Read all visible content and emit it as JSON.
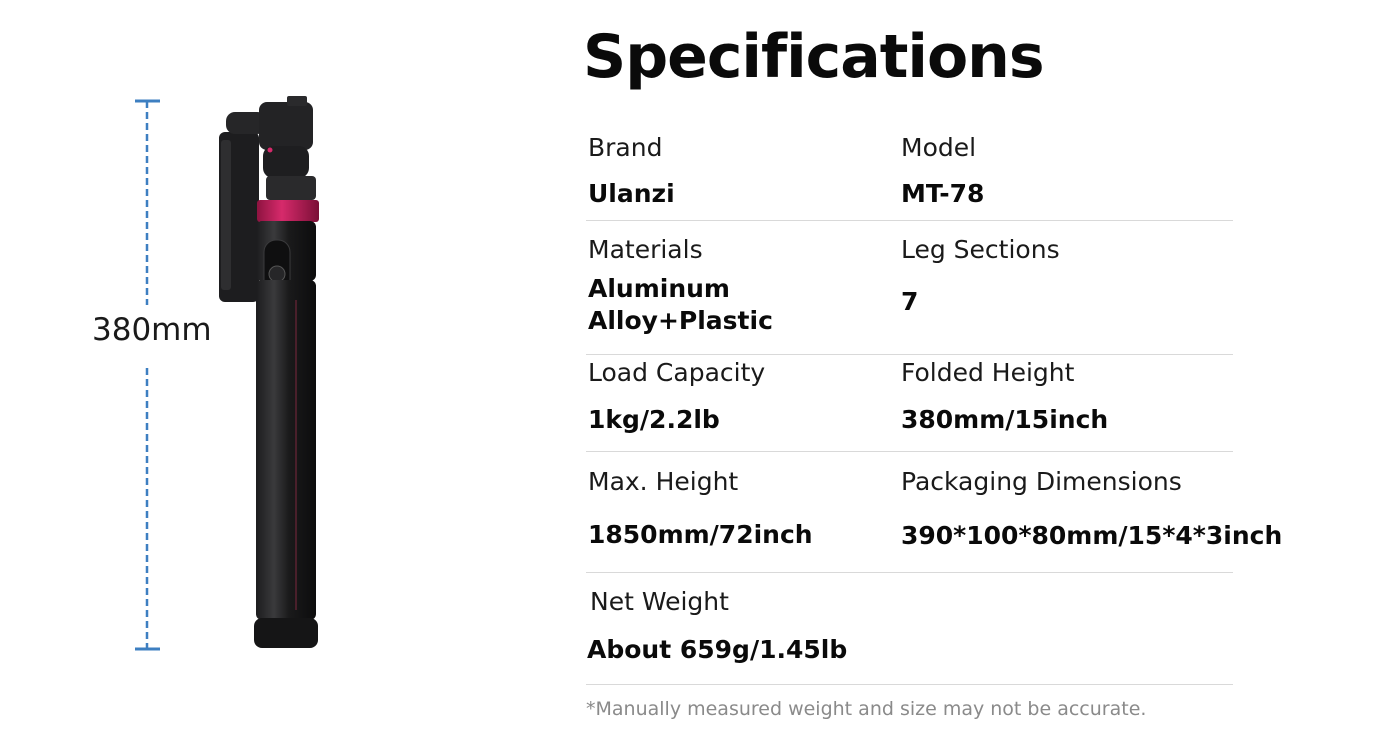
{
  "title": "Specifications",
  "height_indicator": {
    "label": "380mm",
    "color": "#3d7fc1"
  },
  "product_image": {
    "name": "Ulanzi MT-78 tripod folded",
    "accent_color": "#c2205a"
  },
  "specs": {
    "brand": {
      "label": "Brand",
      "value": "Ulanzi"
    },
    "model": {
      "label": "Model",
      "value": "MT-78"
    },
    "materials": {
      "label": "Materials",
      "value_line1": "Aluminum",
      "value_line2": "Alloy+Plastic"
    },
    "leg_sections": {
      "label": "Leg Sections",
      "value": "7"
    },
    "load_capacity": {
      "label": "Load Capacity",
      "value": "1kg/2.2lb"
    },
    "folded_height": {
      "label": "Folded Height",
      "value": "380mm/15inch"
    },
    "max_height": {
      "label": "Max. Height",
      "value": "1850mm/72inch"
    },
    "packaging": {
      "label": "Packaging Dimensions",
      "value": "390*100*80mm/15*4*3inch"
    },
    "net_weight": {
      "label": "Net Weight",
      "value": "About 659g/1.45lb"
    }
  },
  "footnote": "*Manually measured weight and size may not be accurate."
}
